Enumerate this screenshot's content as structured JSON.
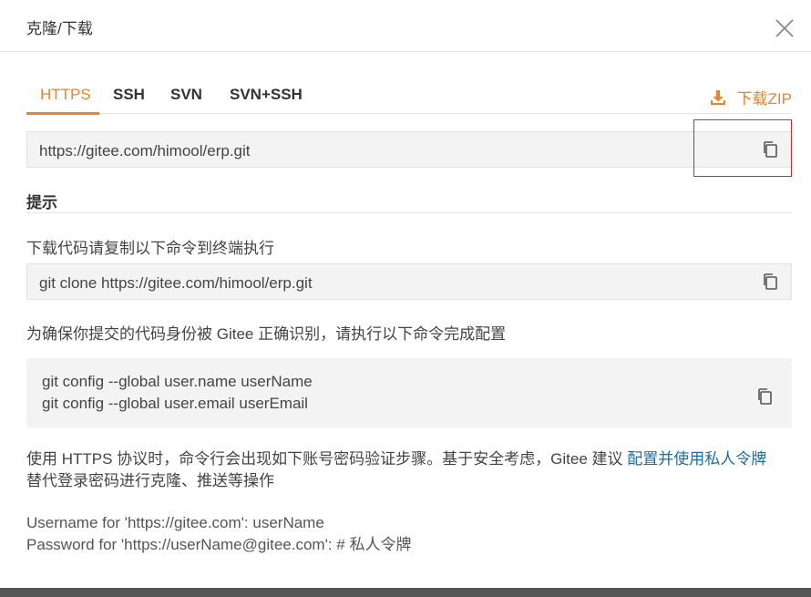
{
  "dialog": {
    "title": "克隆/下载"
  },
  "tabs": [
    {
      "label": "HTTPS",
      "active": true
    },
    {
      "label": "SSH",
      "active": false
    },
    {
      "label": "SVN",
      "active": false
    },
    {
      "label": "SVN+SSH",
      "active": false
    }
  ],
  "download_zip": {
    "label": "下载ZIP",
    "icon": "download-icon"
  },
  "clone_url": "https://gitee.com/himool/erp.git",
  "tips": {
    "title": "提示",
    "download_hint": "下载代码请复制以下命令到终端执行",
    "clone_command": "git clone https://gitee.com/himool/erp.git",
    "config_hint": "为确保你提交的代码身份被 Gitee 正确识别，请执行以下命令完成配置",
    "config_line1": "git config --global user.name userName",
    "config_line2": "git config --global user.email userEmail",
    "https_notice_part1": "使用 HTTPS 协议时，命令行会出现如下账号密码验证步骤。基于安全考虑，Gitee 建议 ",
    "https_notice_link": "配置并使用私人令牌",
    "https_notice_line2": "替代登录密码进行克隆、推送等操作",
    "username_prompt": "Username for 'https://gitee.com': userName",
    "password_prompt": "Password for 'https://userName@gitee.com': # 私人令牌"
  },
  "colors": {
    "accent": "#f0822d",
    "link": "#1c6fa5",
    "highlight_border": "#d9262c"
  }
}
